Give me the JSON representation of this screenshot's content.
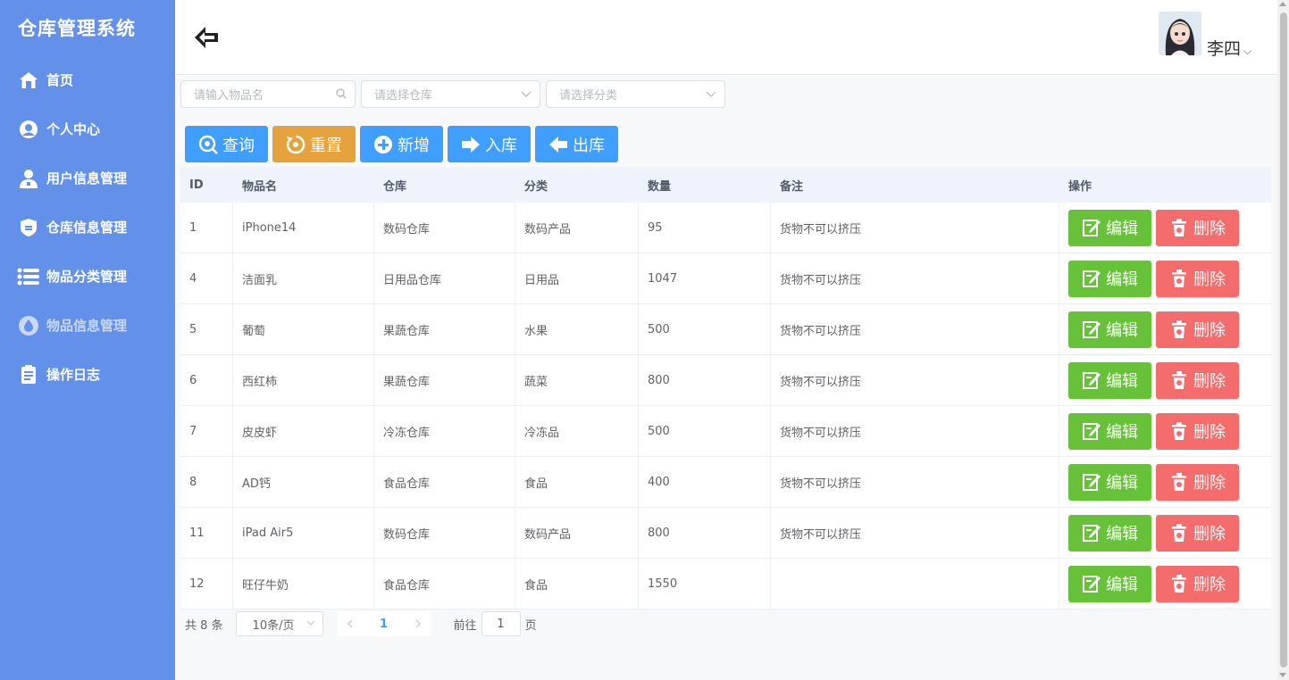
{
  "app": {
    "title": "仓库管理系统"
  },
  "sidebar": {
    "items": [
      {
        "label": "首页",
        "icon": "home-icon"
      },
      {
        "label": "个人中心",
        "icon": "user-circle-icon"
      },
      {
        "label": "用户信息管理",
        "icon": "users-icon"
      },
      {
        "label": "仓库信息管理",
        "icon": "shield-icon"
      },
      {
        "label": "物品分类管理",
        "icon": "list-icon"
      },
      {
        "label": "物品信息管理",
        "icon": "drop-icon",
        "active": true
      },
      {
        "label": "操作日志",
        "icon": "log-icon"
      }
    ]
  },
  "header": {
    "username": "李四",
    "caret": "⌵"
  },
  "filters": {
    "name_placeholder": "请输入物品名",
    "warehouse_placeholder": "请选择仓库",
    "category_placeholder": "请选择分类"
  },
  "toolbar": {
    "query": "查询",
    "reset": "重置",
    "add": "新增",
    "stock_in": "入库",
    "stock_out": "出库"
  },
  "colors": {
    "sidebar": "#6391ea",
    "primary": "#409eff",
    "warning": "#e6a23c",
    "success": "#67c23a",
    "danger": "#f56c6c"
  },
  "table": {
    "columns": [
      "ID",
      "物品名",
      "仓库",
      "分类",
      "数量",
      "备注",
      "操作"
    ],
    "edit_label": "编辑",
    "delete_label": "删除",
    "rows": [
      [
        "1",
        "iPhone14",
        "数码仓库",
        "数码产品",
        "95",
        "货物不可以挤压"
      ],
      [
        "4",
        "洁面乳",
        "日用品仓库",
        "日用品",
        "1047",
        "货物不可以挤压"
      ],
      [
        "5",
        "葡萄",
        "果蔬仓库",
        "水果",
        "500",
        "货物不可以挤压"
      ],
      [
        "6",
        "西红柿",
        "果蔬仓库",
        "蔬菜",
        "800",
        "货物不可以挤压"
      ],
      [
        "7",
        "皮皮虾",
        "冷冻仓库",
        "冷冻品",
        "500",
        "货物不可以挤压"
      ],
      [
        "8",
        "AD钙",
        "食品仓库",
        "食品",
        "400",
        "货物不可以挤压"
      ],
      [
        "11",
        "iPad Air5",
        "数码仓库",
        "数码产品",
        "800",
        "货物不可以挤压"
      ],
      [
        "12",
        "旺仔牛奶",
        "食品仓库",
        "食品",
        "1550",
        ""
      ]
    ]
  },
  "pagination": {
    "total": "共 8 条",
    "page_size": "10条/页",
    "current": "1",
    "goto_label": "前往",
    "goto_value": "1",
    "page_word": "页"
  }
}
